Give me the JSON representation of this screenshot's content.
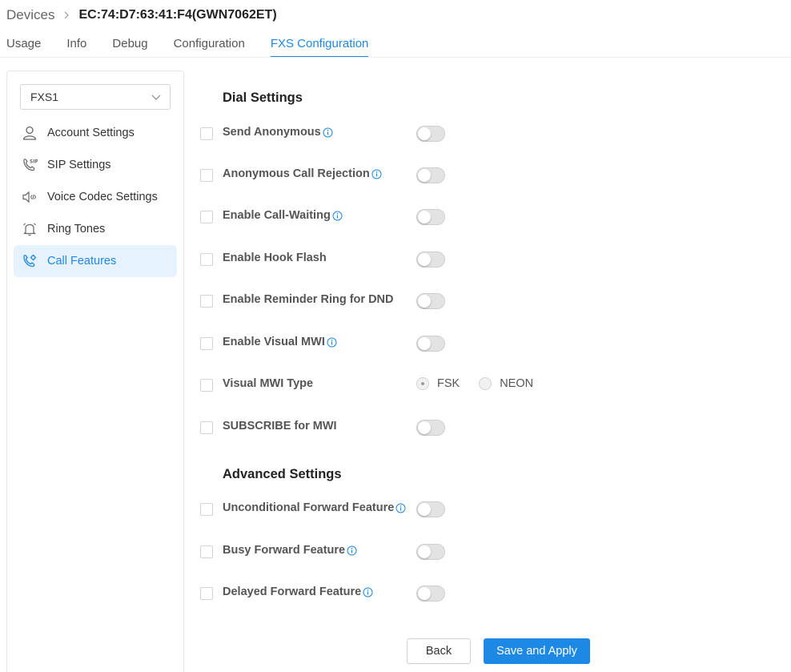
{
  "breadcrumb": {
    "root": "Devices",
    "current": "EC:74:D7:63:41:F4(GWN7062ET)"
  },
  "tabs": [
    {
      "label": "Usage",
      "active": false
    },
    {
      "label": "Info",
      "active": false
    },
    {
      "label": "Debug",
      "active": false
    },
    {
      "label": "Configuration",
      "active": false
    },
    {
      "label": "FXS Configuration",
      "active": true
    }
  ],
  "sidebar": {
    "port_select": "FXS1",
    "items": [
      {
        "label": "Account Settings",
        "icon": "user-icon"
      },
      {
        "label": "SIP Settings",
        "icon": "sip-phone-icon"
      },
      {
        "label": "Voice Codec Settings",
        "icon": "speaker-code-icon"
      },
      {
        "label": "Ring Tones",
        "icon": "bell-icon"
      },
      {
        "label": "Call Features",
        "icon": "phone-gear-icon",
        "active": true
      }
    ]
  },
  "dial_settings": {
    "title": "Dial Settings",
    "rows": [
      {
        "label": "Send Anonymous",
        "info": true,
        "control": "toggle",
        "value": false
      },
      {
        "label": "Anonymous Call Rejection",
        "info": true,
        "control": "toggle",
        "value": false
      },
      {
        "label": "Enable Call-Waiting",
        "info": true,
        "control": "toggle",
        "value": false
      },
      {
        "label": "Enable Hook Flash",
        "info": false,
        "control": "toggle",
        "value": false
      },
      {
        "label": "Enable Reminder Ring for DND",
        "info": false,
        "control": "toggle",
        "value": false
      },
      {
        "label": "Enable Visual MWI",
        "info": true,
        "control": "toggle",
        "value": false
      },
      {
        "label": "Visual MWI Type",
        "info": false,
        "control": "radio",
        "options": [
          "FSK",
          "NEON"
        ],
        "selected": "FSK"
      },
      {
        "label": "SUBSCRIBE for MWI",
        "info": false,
        "control": "toggle",
        "value": false
      }
    ]
  },
  "advanced_settings": {
    "title": "Advanced Settings",
    "rows": [
      {
        "label": "Unconditional Forward Feature",
        "info": true,
        "control": "toggle",
        "value": false
      },
      {
        "label": "Busy Forward Feature",
        "info": true,
        "control": "toggle",
        "value": false
      },
      {
        "label": "Delayed Forward Feature",
        "info": true,
        "control": "toggle",
        "value": false
      }
    ]
  },
  "buttons": {
    "back": "Back",
    "save": "Save and Apply"
  },
  "colors": {
    "accent": "#1e88e5",
    "active_menu_bg": "#e6f2fd"
  }
}
